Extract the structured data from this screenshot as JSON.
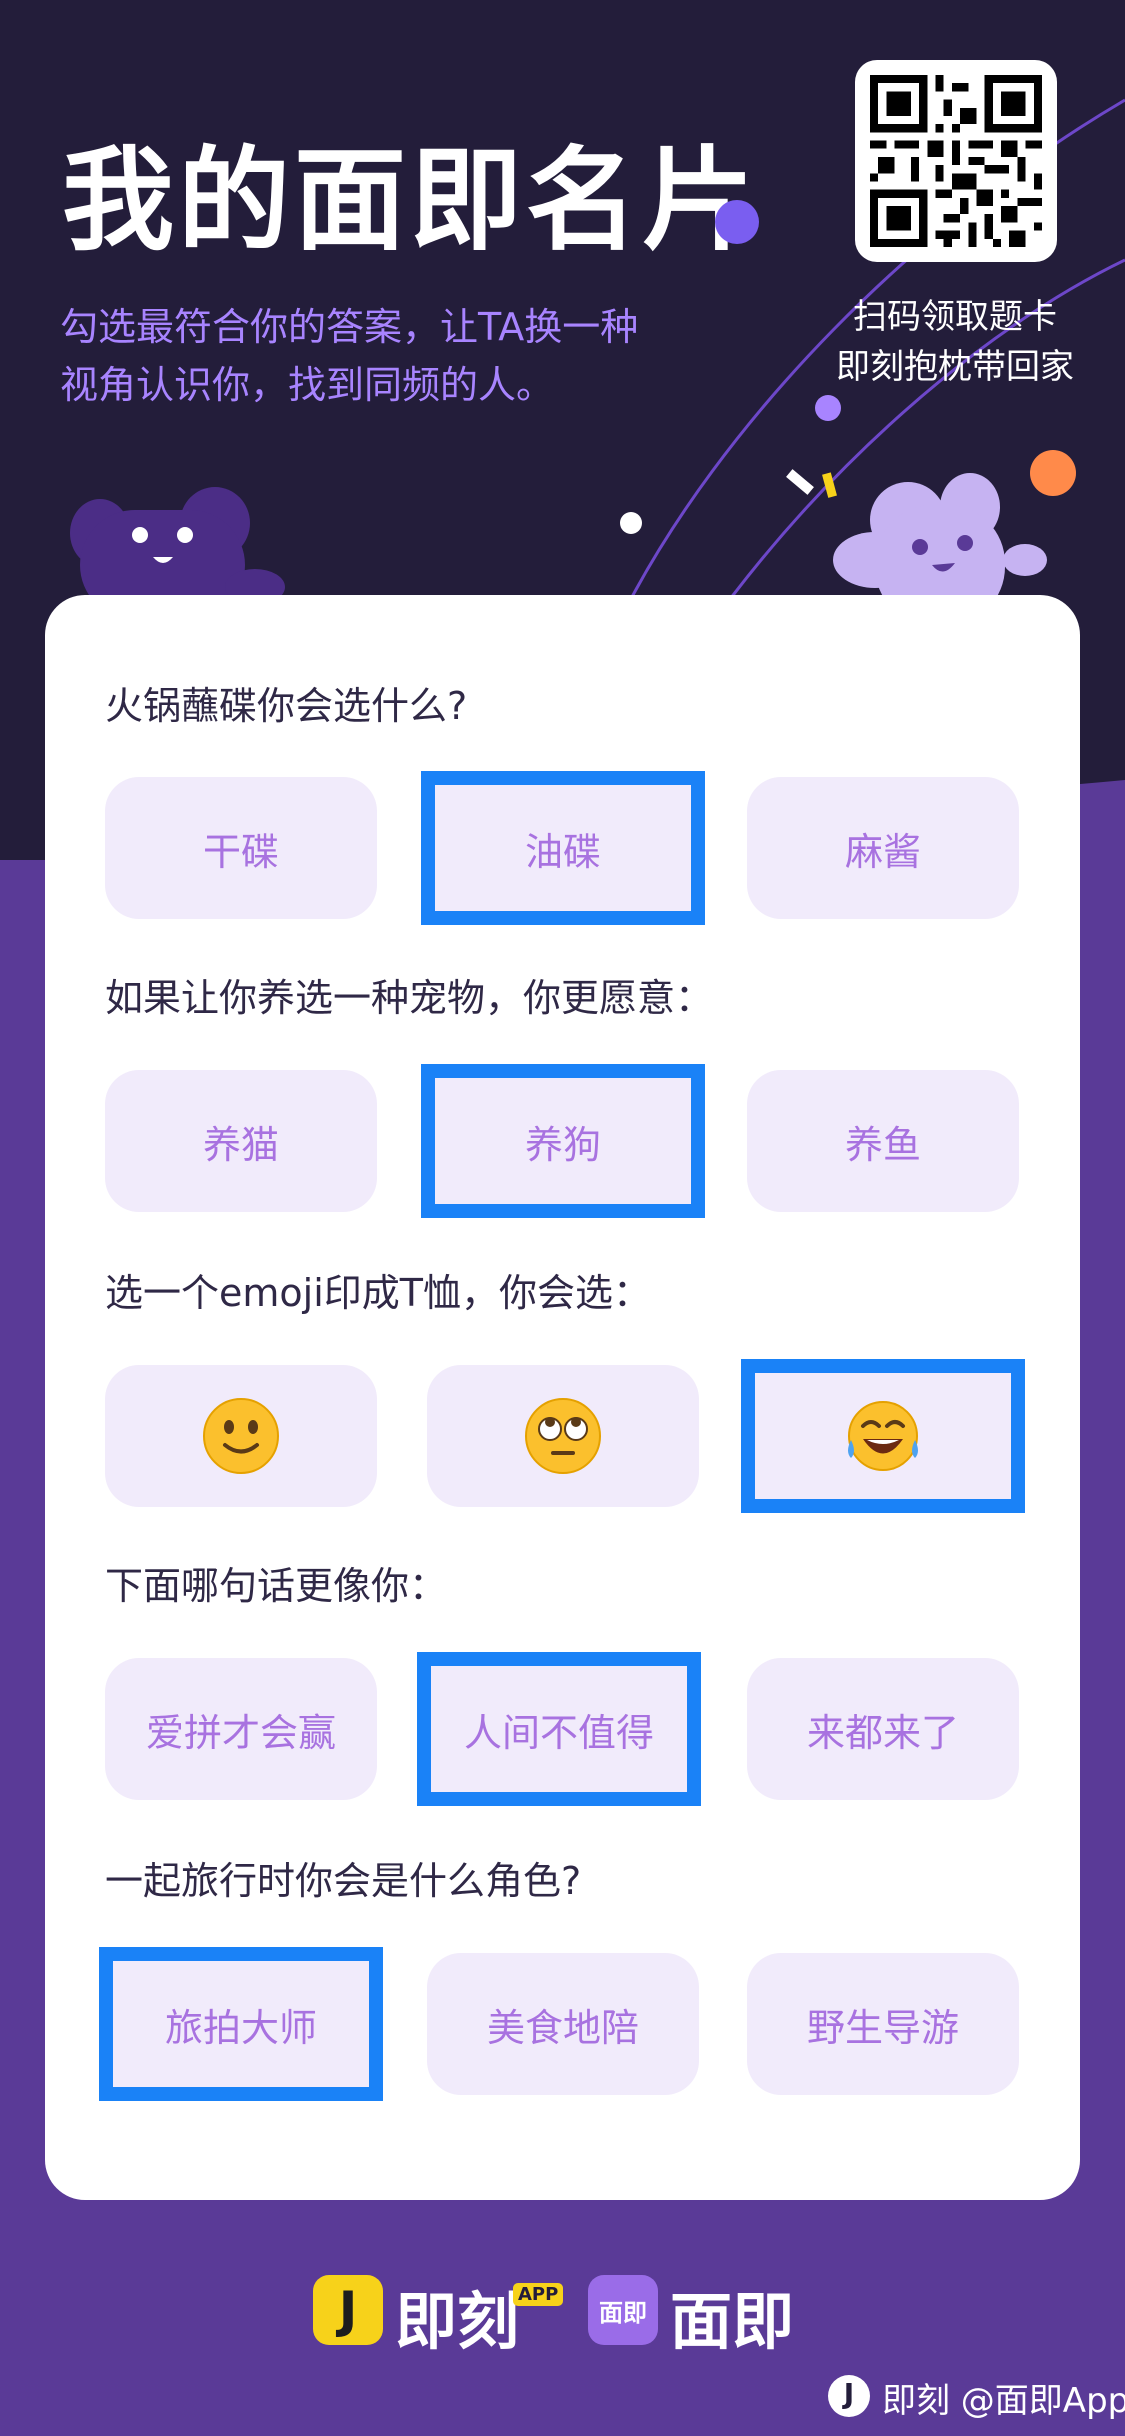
{
  "header": {
    "title": "我的面即名片",
    "subtitle_line1": "勾选最符合你的答案，让TA换一种",
    "subtitle_line2": "视角认识你，找到同频的人。",
    "qr_caption_line1": "扫码领取题卡",
    "qr_caption_line2": "即刻抱枕带回家"
  },
  "questions": [
    {
      "text": "火锅蘸碟你会选什么?",
      "options": [
        "干碟",
        "油碟",
        "麻酱"
      ],
      "selected": 1
    },
    {
      "text": "如果让你养选一种宠物，你更愿意：",
      "options": [
        "养猫",
        "养狗",
        "养鱼"
      ],
      "selected": 1
    },
    {
      "text": "选一个emoji印成T恤，你会选：",
      "options": [
        "slightly-smiling-face",
        "face-with-rolling-eyes",
        "face-with-tears-of-joy"
      ],
      "selected": 2
    },
    {
      "text": "下面哪句话更像你：",
      "options": [
        "爱拼才会赢",
        "人间不值得",
        "来都来了"
      ],
      "selected": 1
    },
    {
      "text": "一起旅行时你会是什么角色?",
      "options": [
        "旅拍大师",
        "美食地陪",
        "野生导游"
      ],
      "selected": 0
    }
  ],
  "footer": {
    "jike_icon_letter": "J",
    "jike_name": "即刻",
    "app_badge": "APP",
    "mianji_icon_text": "面即",
    "mianji_name": "面即",
    "watermark_icon": "J",
    "watermark": "即刻 @面即App"
  },
  "colors": {
    "background_dark": "#231d3a",
    "background_purple": "#5a3a97",
    "accent_purple": "#a884ff",
    "option_bg": "#f1ebfb",
    "option_text": "#a872e0",
    "selection_border": "#1a82f7",
    "logo_yellow": "#f7d21a"
  }
}
